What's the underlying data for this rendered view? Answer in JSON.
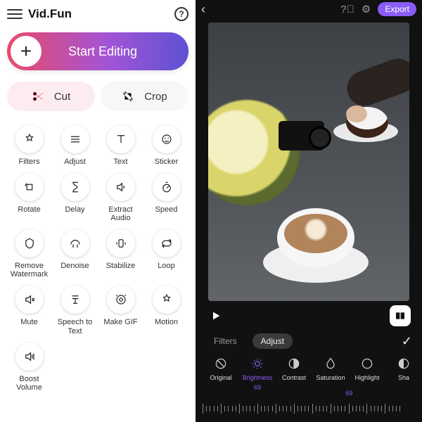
{
  "app": {
    "title": "Vid.Fun"
  },
  "start": {
    "label": "Start Editing"
  },
  "cut": {
    "label": "Cut"
  },
  "crop": {
    "label": "Crop"
  },
  "tools": [
    {
      "id": "filters",
      "label": "Filters"
    },
    {
      "id": "adjust",
      "label": "Adjust"
    },
    {
      "id": "text",
      "label": "Text"
    },
    {
      "id": "sticker",
      "label": "Sticker"
    },
    {
      "id": "rotate",
      "label": "Rotate"
    },
    {
      "id": "delay",
      "label": "Delay"
    },
    {
      "id": "extract-audio",
      "label": "Extract Audio"
    },
    {
      "id": "speed",
      "label": "Speed"
    },
    {
      "id": "remove-watermark",
      "label": "Remove\nWatermark"
    },
    {
      "id": "denoise",
      "label": "Denoise"
    },
    {
      "id": "stabilize",
      "label": "Stabilize"
    },
    {
      "id": "loop",
      "label": "Loop"
    },
    {
      "id": "mute",
      "label": "Mute"
    },
    {
      "id": "speech-to-text",
      "label": "Speech to\nText"
    },
    {
      "id": "make-gif",
      "label": "Make GIF"
    },
    {
      "id": "motion",
      "label": "Motion"
    },
    {
      "id": "boost-volume",
      "label": "Boost\nVolume"
    }
  ],
  "editor": {
    "export": "Export",
    "tabs": {
      "filters": "Filters",
      "adjust": "Adjust",
      "active": "adjust"
    },
    "adjustments": [
      {
        "id": "original",
        "label": "Original"
      },
      {
        "id": "brightness",
        "label": "Brightness",
        "value": 69,
        "active": true
      },
      {
        "id": "contrast",
        "label": "Contrast"
      },
      {
        "id": "saturation",
        "label": "Saturation"
      },
      {
        "id": "highlight",
        "label": "Highlight"
      },
      {
        "id": "shadow",
        "label": "Sha"
      }
    ],
    "slider": {
      "value": 69,
      "min": 0,
      "max": 100
    }
  }
}
